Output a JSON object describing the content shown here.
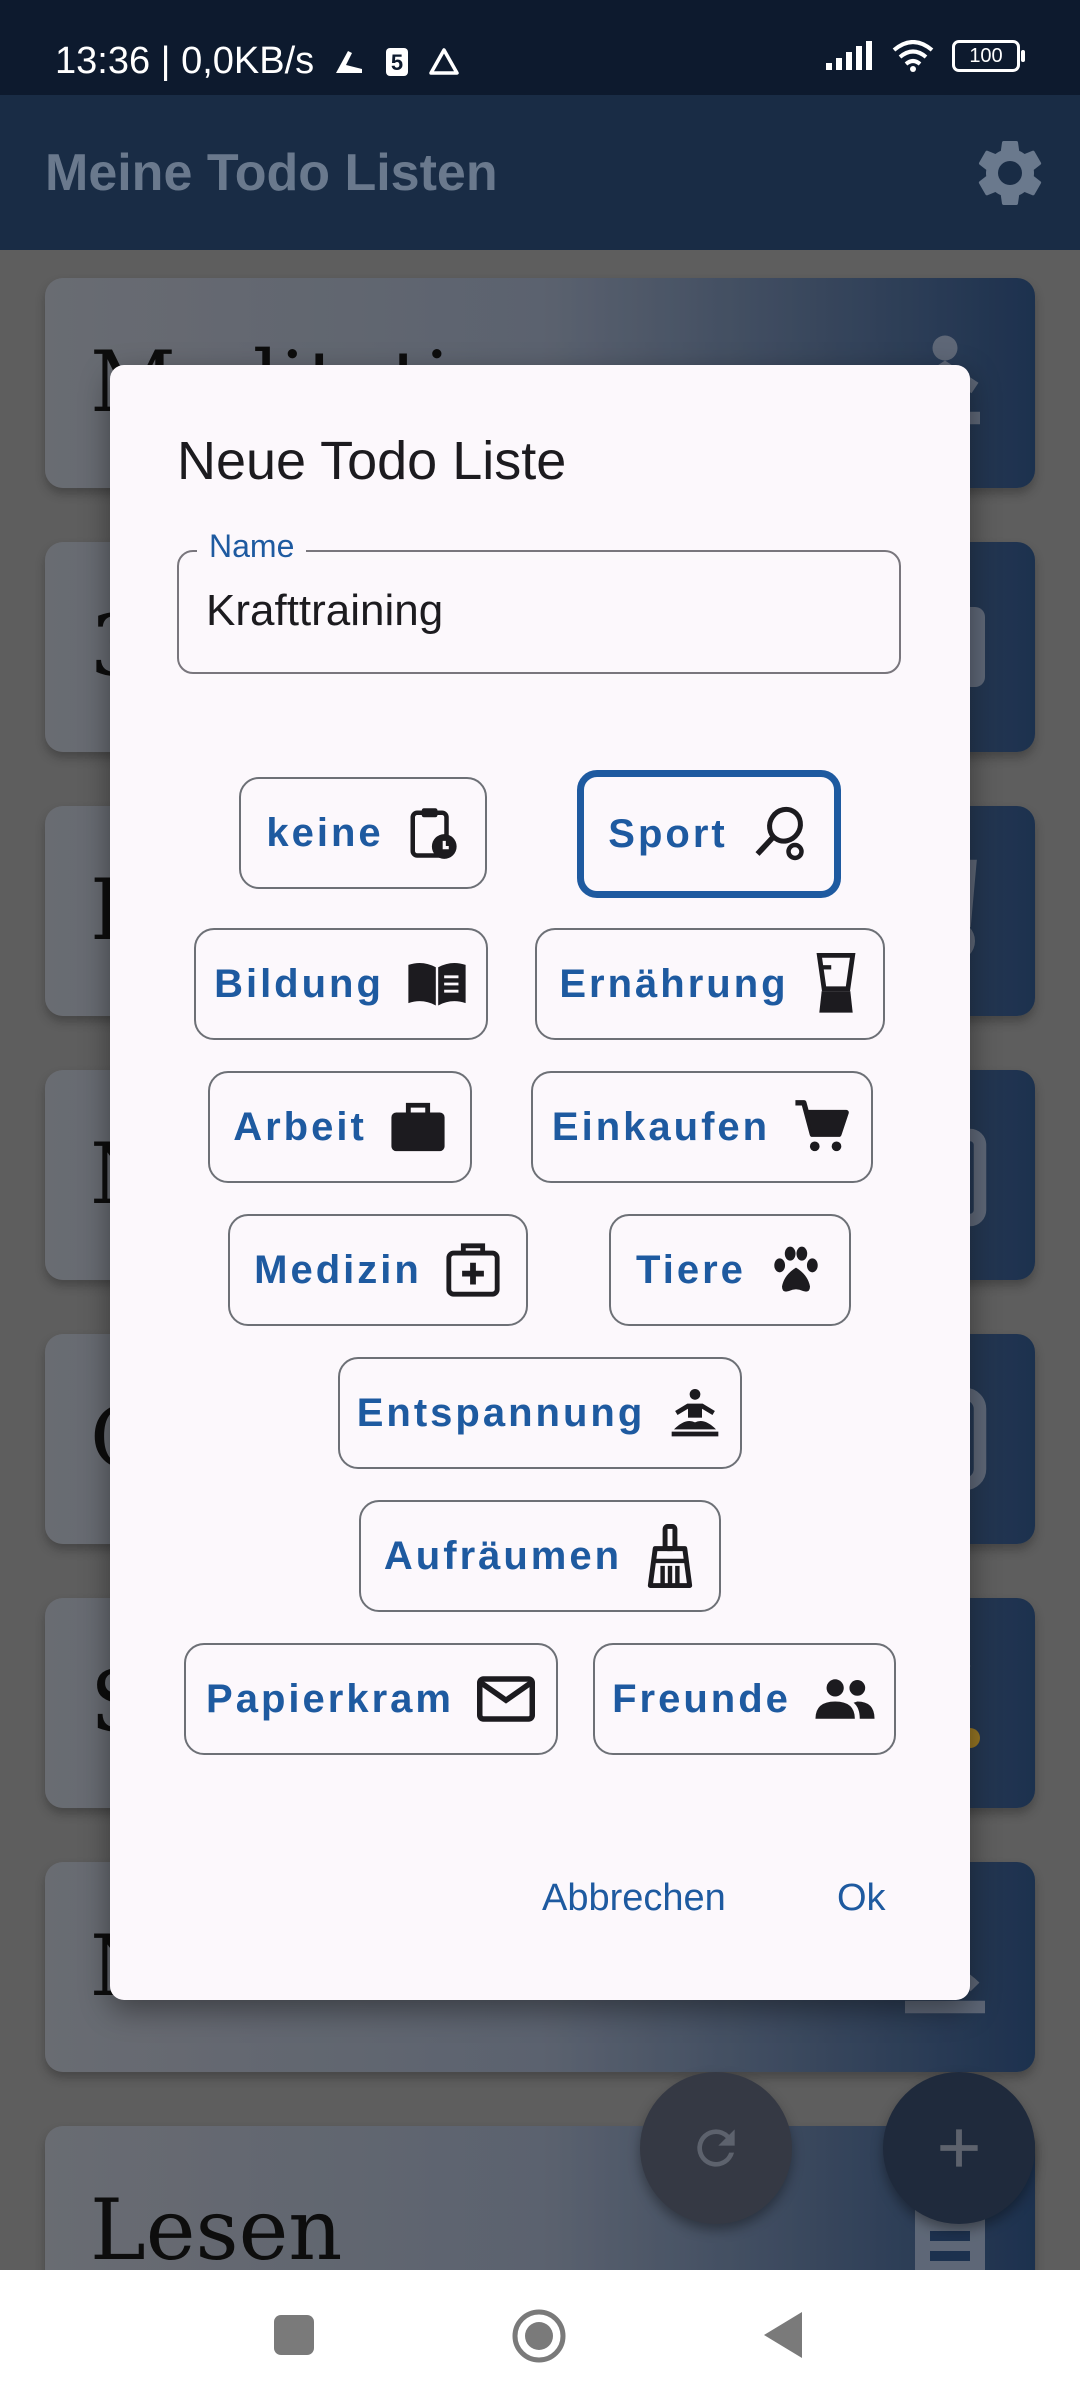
{
  "status_bar": {
    "left_text": "13:36 | 0,0KB/s",
    "battery": "100"
  },
  "app_bar": {
    "title": "Meine Todo Listen",
    "settings_icon": "gear-icon"
  },
  "lists": [
    {
      "name": "Meditation",
      "icon": "meditation-icon"
    },
    {
      "name": "3",
      "icon": "tablet-icon"
    },
    {
      "name": "E",
      "icon": "blender-icon"
    },
    {
      "name": "N",
      "icon": "tablet-icon"
    },
    {
      "name": "C",
      "icon": "document-icon"
    },
    {
      "name": "S",
      "icon": "sport-icon"
    },
    {
      "name": "N",
      "icon": "meditation-icon"
    },
    {
      "name": "Lesen",
      "icon": "book-icon"
    }
  ],
  "dialog": {
    "title": "Neue Todo Liste",
    "name_label": "Name",
    "name_value": "Krafttraining",
    "categories": [
      {
        "label": "keine",
        "icon": "clipboard-clock-icon",
        "selected": false
      },
      {
        "label": "Sport",
        "icon": "racket-icon",
        "selected": true
      },
      {
        "label": "Bildung",
        "icon": "open-book-icon",
        "selected": false
      },
      {
        "label": "Ernährung",
        "icon": "blender-icon",
        "selected": false
      },
      {
        "label": "Arbeit",
        "icon": "briefcase-icon",
        "selected": false
      },
      {
        "label": "Einkaufen",
        "icon": "shopping-cart-icon",
        "selected": false
      },
      {
        "label": "Medizin",
        "icon": "medical-kit-icon",
        "selected": false
      },
      {
        "label": "Tiere",
        "icon": "paw-icon",
        "selected": false
      },
      {
        "label": "Entspannung",
        "icon": "meditation-icon",
        "selected": false
      },
      {
        "label": "Aufräumen",
        "icon": "broom-icon",
        "selected": false
      },
      {
        "label": "Papierkram",
        "icon": "mail-icon",
        "selected": false
      },
      {
        "label": "Freunde",
        "icon": "people-icon",
        "selected": false
      }
    ],
    "cancel_label": "Abbrechen",
    "ok_label": "Ok"
  },
  "colors": {
    "accent": "#1e5aa0",
    "app_bar": "#1e3452",
    "dialog_bg": "#fcf8fc"
  }
}
